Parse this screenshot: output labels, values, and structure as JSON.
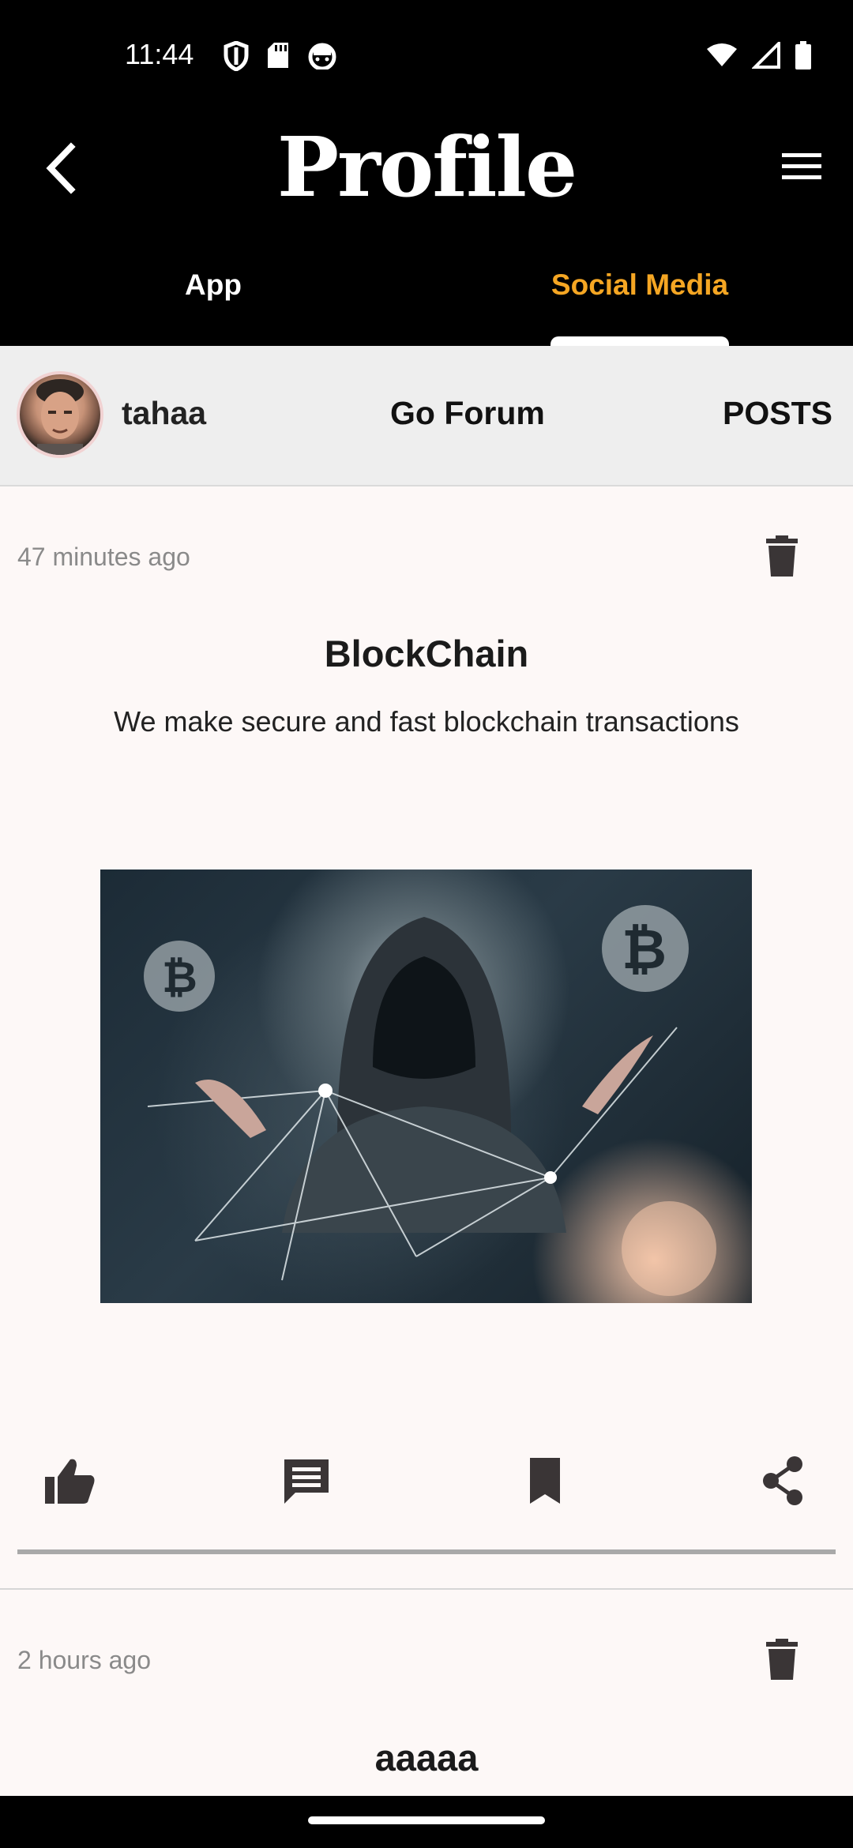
{
  "status_bar": {
    "time": "11:44",
    "icons_left": [
      "shield-icon",
      "sd-card-icon",
      "android-face-icon"
    ],
    "icons_right": [
      "wifi-icon",
      "signal-icon",
      "battery-icon"
    ]
  },
  "app_bar": {
    "title": "Profile",
    "back_icon": "back-arrow-icon",
    "menu_icon": "hamburger-menu-icon"
  },
  "tabs": [
    {
      "label": "App",
      "selected": false
    },
    {
      "label": "Social Media",
      "selected": true
    }
  ],
  "colors": {
    "accent": "#f5a623",
    "header_bg": "#000000",
    "page_bg": "#fdf8f7",
    "profile_row_bg": "#eeeeee"
  },
  "profile": {
    "username": "tahaa",
    "forum_link": "Go Forum",
    "posts_link": "POSTS"
  },
  "posts": [
    {
      "time": "47 minutes ago",
      "title": "BlockChain",
      "body": "We make secure and fast blockchain transactions",
      "image_alt": "hooded hacker with bitcoin network",
      "actions": [
        "thumb-up-icon",
        "comment-icon",
        "bookmark-icon",
        "share-icon"
      ]
    },
    {
      "time": "2 hours ago",
      "title": "aaaaa"
    }
  ]
}
